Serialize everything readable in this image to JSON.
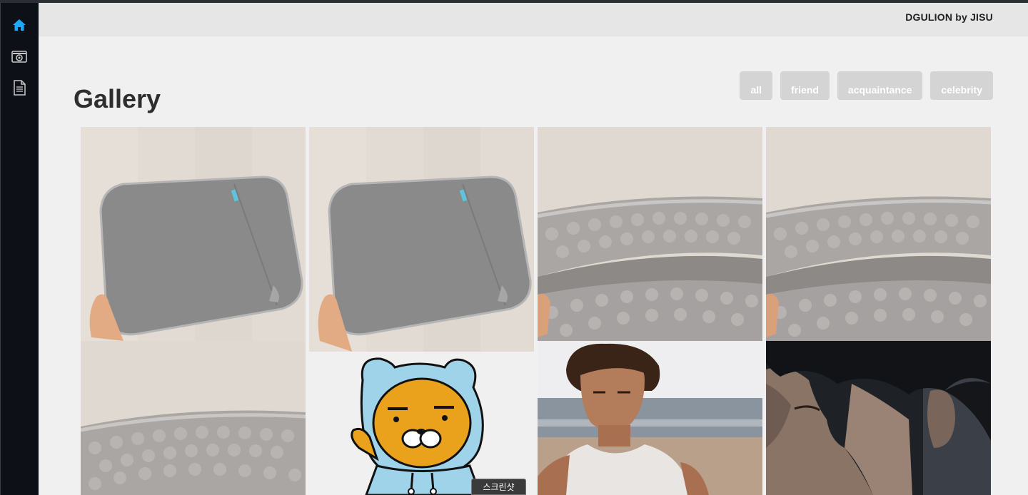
{
  "app": {
    "brand": "DGULION by JISU"
  },
  "sidebar": {
    "items": [
      {
        "icon": "home-icon",
        "active": true
      },
      {
        "icon": "camera-icon",
        "active": false
      },
      {
        "icon": "document-icon",
        "active": false
      }
    ],
    "active_color": "#1ea7fd"
  },
  "page": {
    "title": "Gallery"
  },
  "filters": [
    {
      "label": "all"
    },
    {
      "label": "friend"
    },
    {
      "label": "acquaintance"
    },
    {
      "label": "celebrity"
    }
  ],
  "gallery": {
    "photos": [
      {
        "subject": "gray laptop sleeve (front)"
      },
      {
        "subject": "gray laptop sleeve (front)"
      },
      {
        "subject": "laptop sleeve padded interior"
      },
      {
        "subject": "laptop sleeve padded interior"
      },
      {
        "subject": "laptop sleeve padded interior"
      },
      {
        "subject": "Kakao Ryan character waving"
      },
      {
        "subject": "man on beach"
      },
      {
        "subject": "man in profile, close-up"
      }
    ]
  },
  "tooltip": {
    "text": "스크린샷"
  }
}
